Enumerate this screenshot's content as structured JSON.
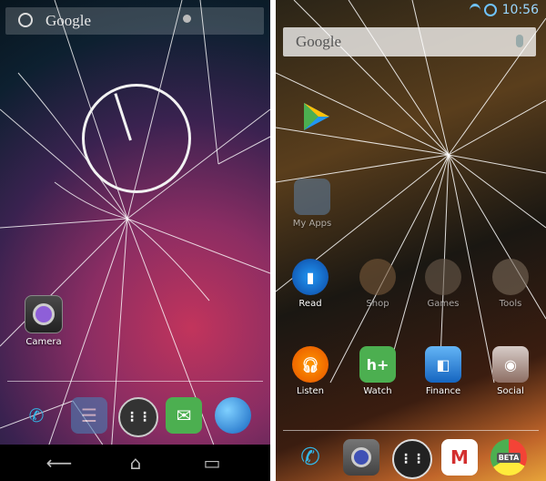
{
  "left_screen": {
    "search": {
      "logo_text": "Google"
    },
    "home_apps": [
      {
        "label": "Camera",
        "icon": "camera-icon"
      }
    ],
    "dock": [
      {
        "name": "phone",
        "icon": "phone-icon"
      },
      {
        "name": "contacts",
        "icon": "contacts-icon"
      },
      {
        "name": "app-drawer",
        "icon": "app-drawer-icon"
      },
      {
        "name": "messaging",
        "icon": "messaging-icon"
      },
      {
        "name": "browser",
        "icon": "globe-icon"
      }
    ],
    "nav": [
      {
        "name": "back",
        "icon": "back-icon",
        "glyph": "⟵"
      },
      {
        "name": "home",
        "icon": "home-icon",
        "glyph": "⌂"
      },
      {
        "name": "recents",
        "icon": "recents-icon",
        "glyph": "▭"
      }
    ]
  },
  "right_screen": {
    "status": {
      "time": "10:56"
    },
    "search": {
      "logo_text": "Google"
    },
    "top_row": [
      {
        "label": "",
        "icon": "play-store-icon"
      }
    ],
    "row1": [
      {
        "label": "My Apps",
        "icon": "my-apps-icon"
      }
    ],
    "row2": [
      {
        "label": "Read",
        "icon": "read-icon"
      },
      {
        "label": "Shop",
        "icon": "shop-icon"
      },
      {
        "label": "Games",
        "icon": "games-icon"
      },
      {
        "label": "Tools",
        "icon": "tools-icon"
      }
    ],
    "row3": [
      {
        "label": "Listen",
        "icon": "listen-icon"
      },
      {
        "label": "Watch",
        "icon": "watch-icon"
      },
      {
        "label": "Finance",
        "icon": "finance-icon"
      },
      {
        "label": "Social",
        "icon": "social-icon"
      }
    ],
    "dock": [
      {
        "name": "phone",
        "icon": "phone-icon"
      },
      {
        "name": "camera",
        "icon": "camera-icon"
      },
      {
        "name": "app-drawer",
        "icon": "app-drawer-icon"
      },
      {
        "name": "gmail",
        "icon": "gmail-icon"
      },
      {
        "name": "chrome-beta",
        "icon": "chrome-beta-icon",
        "badge": "BETA"
      }
    ]
  }
}
